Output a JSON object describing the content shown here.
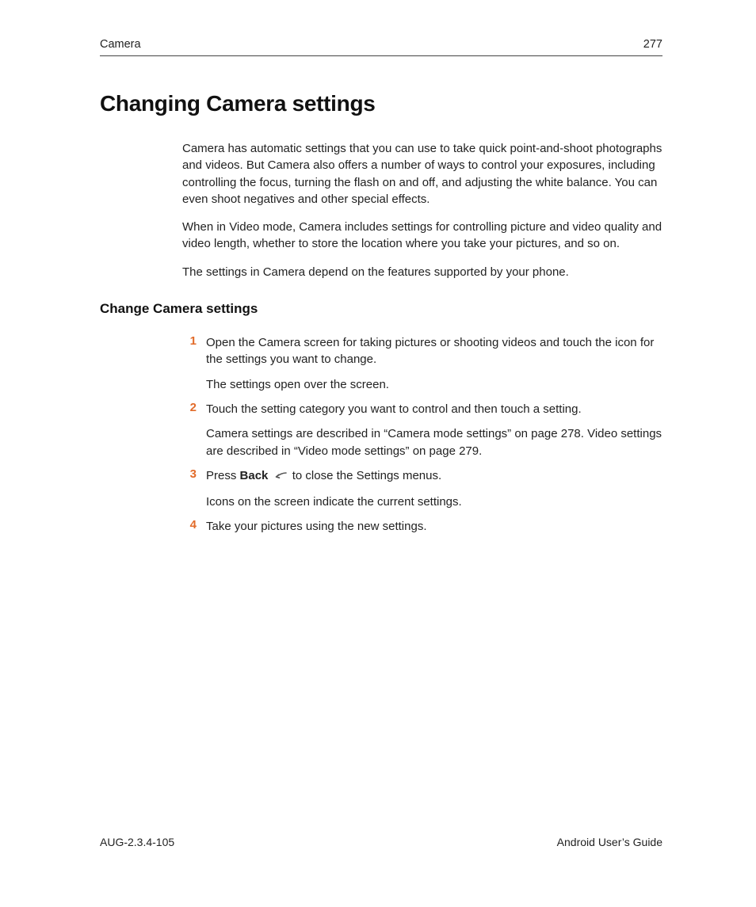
{
  "header": {
    "section": "Camera",
    "page_number": "277"
  },
  "title": "Changing Camera settings",
  "intro": {
    "p1": "Camera has automatic settings that you can use to take quick point-and-shoot photographs and videos. But Camera also offers a number of ways to control your exposures, including controlling the focus, turning the flash on and off, and adjusting the white balance. You can even shoot negatives and other special effects.",
    "p2": "When in Video mode, Camera includes settings for controlling picture and video quality and video length, whether to store the location where you take your pictures, and so on.",
    "p3": "The settings in Camera depend on the features supported by your phone."
  },
  "subhead": "Change Camera settings",
  "steps": [
    {
      "num": "1",
      "lead": "Open the Camera screen for taking pictures or shooting videos and touch the icon for the settings you want to change.",
      "follow": "The settings open over the screen."
    },
    {
      "num": "2",
      "lead": "Touch the setting category you want to control and then touch a setting.",
      "follow": "Camera settings are described in “Camera mode settings” on page 278. Video settings are described in “Video mode settings” on page 279."
    },
    {
      "num": "3",
      "lead_prefix": "Press ",
      "lead_bold": "Back",
      "lead_suffix": " to close the Settings menus.",
      "follow": "Icons on the screen indicate the current settings."
    },
    {
      "num": "4",
      "lead": "Take your pictures using the new settings."
    }
  ],
  "footer": {
    "left": "AUG-2.3.4-105",
    "right": "Android User’s Guide"
  }
}
